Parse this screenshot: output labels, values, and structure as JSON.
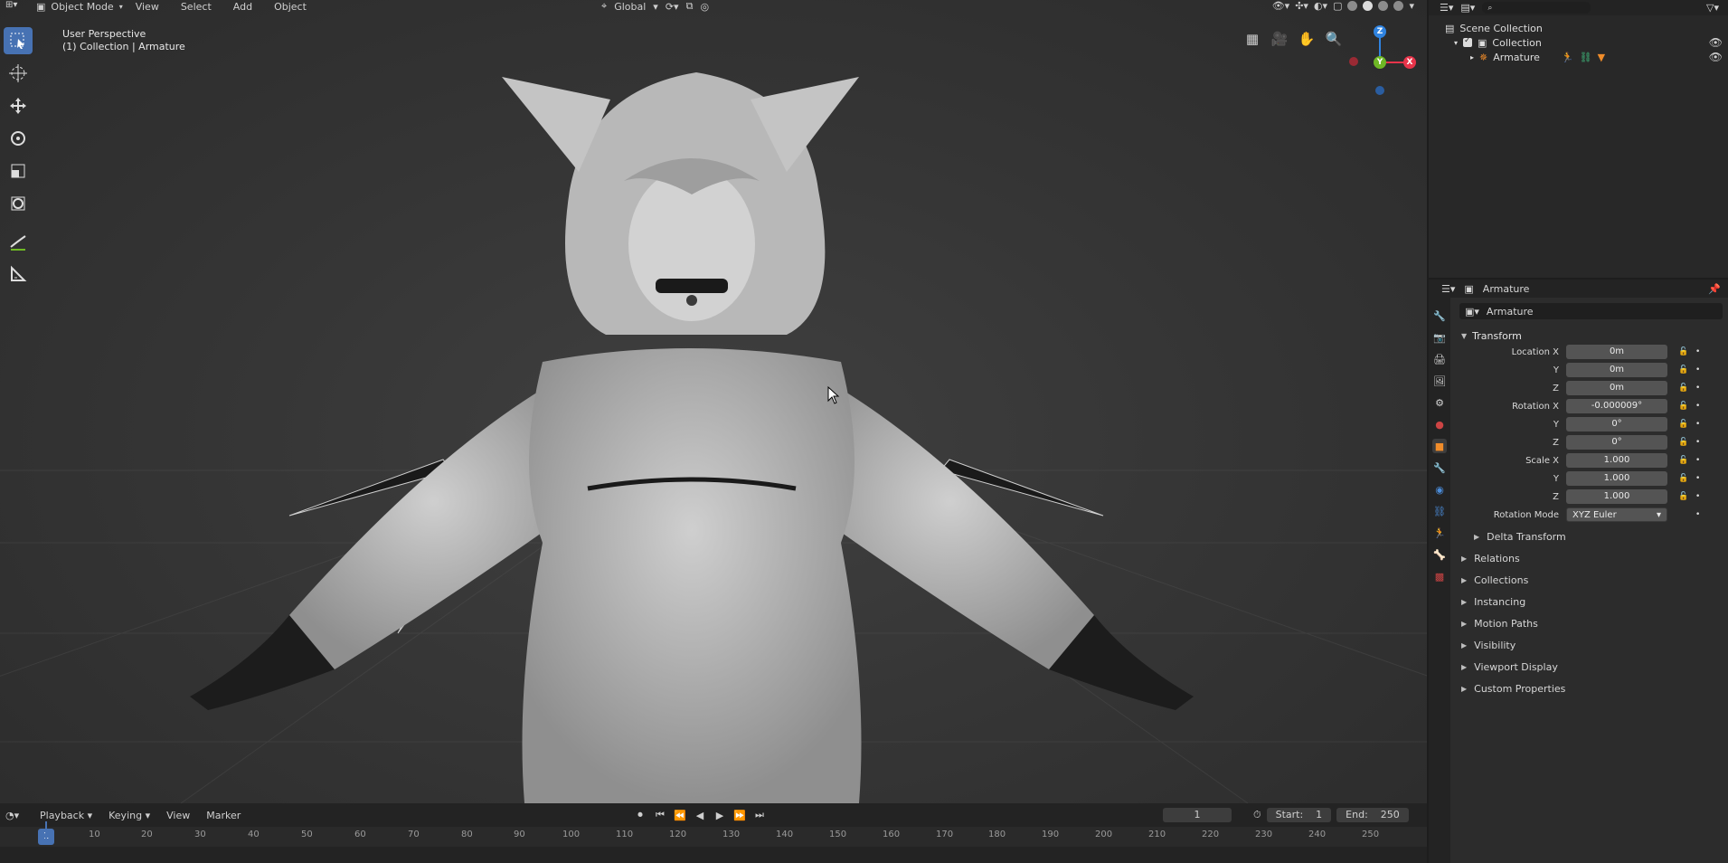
{
  "viewport": {
    "header": {
      "mode": "Object Mode",
      "menu": [
        "View",
        "Select",
        "Add",
        "Object"
      ],
      "orientation": "Global"
    },
    "info_line1": "User Perspective",
    "info_line2": "(1) Collection | Armature",
    "tools": [
      "select-box-icon",
      "cursor-icon",
      "move-icon",
      "rotate-icon",
      "scale-icon",
      "transform-icon",
      "annotate-icon",
      "measure-icon"
    ],
    "gizmo_labels": {
      "z": "Z",
      "y": "Y",
      "x": "X"
    }
  },
  "outliner": {
    "rows": [
      {
        "label": "Scene Collection"
      },
      {
        "label": "Collection"
      },
      {
        "label": "Armature"
      }
    ]
  },
  "properties": {
    "header_title": "Armature",
    "object_name": "Armature",
    "transform": {
      "title": "Transform",
      "location_label": "Location X",
      "location": [
        "0m",
        "0m",
        "0m"
      ],
      "rotation_label": "Rotation X",
      "rotation": [
        "-0.000009°",
        "0°",
        "0°"
      ],
      "scale_label": "Scale X",
      "scale": [
        "1.000",
        "1.000",
        "1.000"
      ],
      "axis_y": "Y",
      "axis_z": "Z",
      "rotation_mode_label": "Rotation Mode",
      "rotation_mode": "XYZ Euler"
    },
    "delta_transform": "Delta Transform",
    "panels": [
      "Relations",
      "Collections",
      "Instancing",
      "Motion Paths",
      "Visibility",
      "Viewport Display",
      "Custom Properties"
    ]
  },
  "timeline": {
    "menu": [
      "Playback",
      "Keying",
      "View",
      "Marker"
    ],
    "current_frame": "1",
    "start_label": "Start:",
    "start": "1",
    "end_label": "End:",
    "end": "250",
    "ruler_current": "1",
    "ruler_ticks": [
      "10",
      "20",
      "30",
      "40",
      "50",
      "60",
      "70",
      "80",
      "90",
      "100",
      "110",
      "120",
      "130",
      "140",
      "150",
      "160",
      "170",
      "180",
      "190",
      "200",
      "210",
      "220",
      "230",
      "240",
      "250"
    ]
  },
  "colors": {
    "accent": "#4772b3",
    "axis_x": "#e8344a",
    "axis_y": "#6fb825",
    "axis_z": "#2f83e0",
    "object_orange": "#f08c2a"
  }
}
